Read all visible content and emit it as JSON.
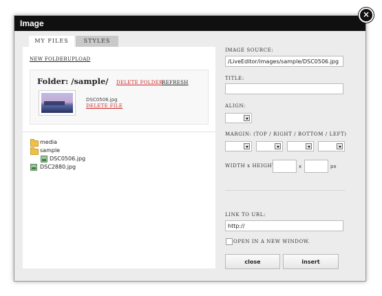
{
  "dialog": {
    "title": "Image",
    "close_glyph": "×"
  },
  "tabs": [
    {
      "label": "MY FILES",
      "active": true
    },
    {
      "label": "STYLES",
      "active": false
    }
  ],
  "toolbar": {
    "new_folder": "NEW FOLDER",
    "upload": "UPLOAD"
  },
  "folder": {
    "title": "Folder: /sample/",
    "delete_folder": "DELETE FOLDER",
    "refresh": "REFRESH",
    "file_name": "DSC0506.jpg",
    "delete_file": "DELETE FILE"
  },
  "tree": [
    {
      "label": "media",
      "icon": "folder-icon"
    },
    {
      "label": "sample",
      "icon": "folder-icon"
    },
    {
      "label": "DSC0506.jpg",
      "icon": "image-file-icon"
    },
    {
      "label": "DSC2880.jpg",
      "icon": "image-file-icon"
    }
  ],
  "form": {
    "image_source_label": "IMAGE SOURCE:",
    "image_source_value": "/LiveEditor/images/sample/DSC0506.jpg",
    "title_label": "TITLE:",
    "title_value": "",
    "align_label": "ALIGN:",
    "margin_label": "MARGIN: (TOP / RIGHT / BOTTOM / LEFT)",
    "size_label": "WIDTH x HEIGHT:",
    "size_x": "x",
    "size_unit": "px",
    "link_label": "LINK TO URL:",
    "link_value": "http://",
    "new_window_label": "OPEN IN A NEW WINDOW."
  },
  "buttons": {
    "close": "close",
    "insert": "insert"
  }
}
